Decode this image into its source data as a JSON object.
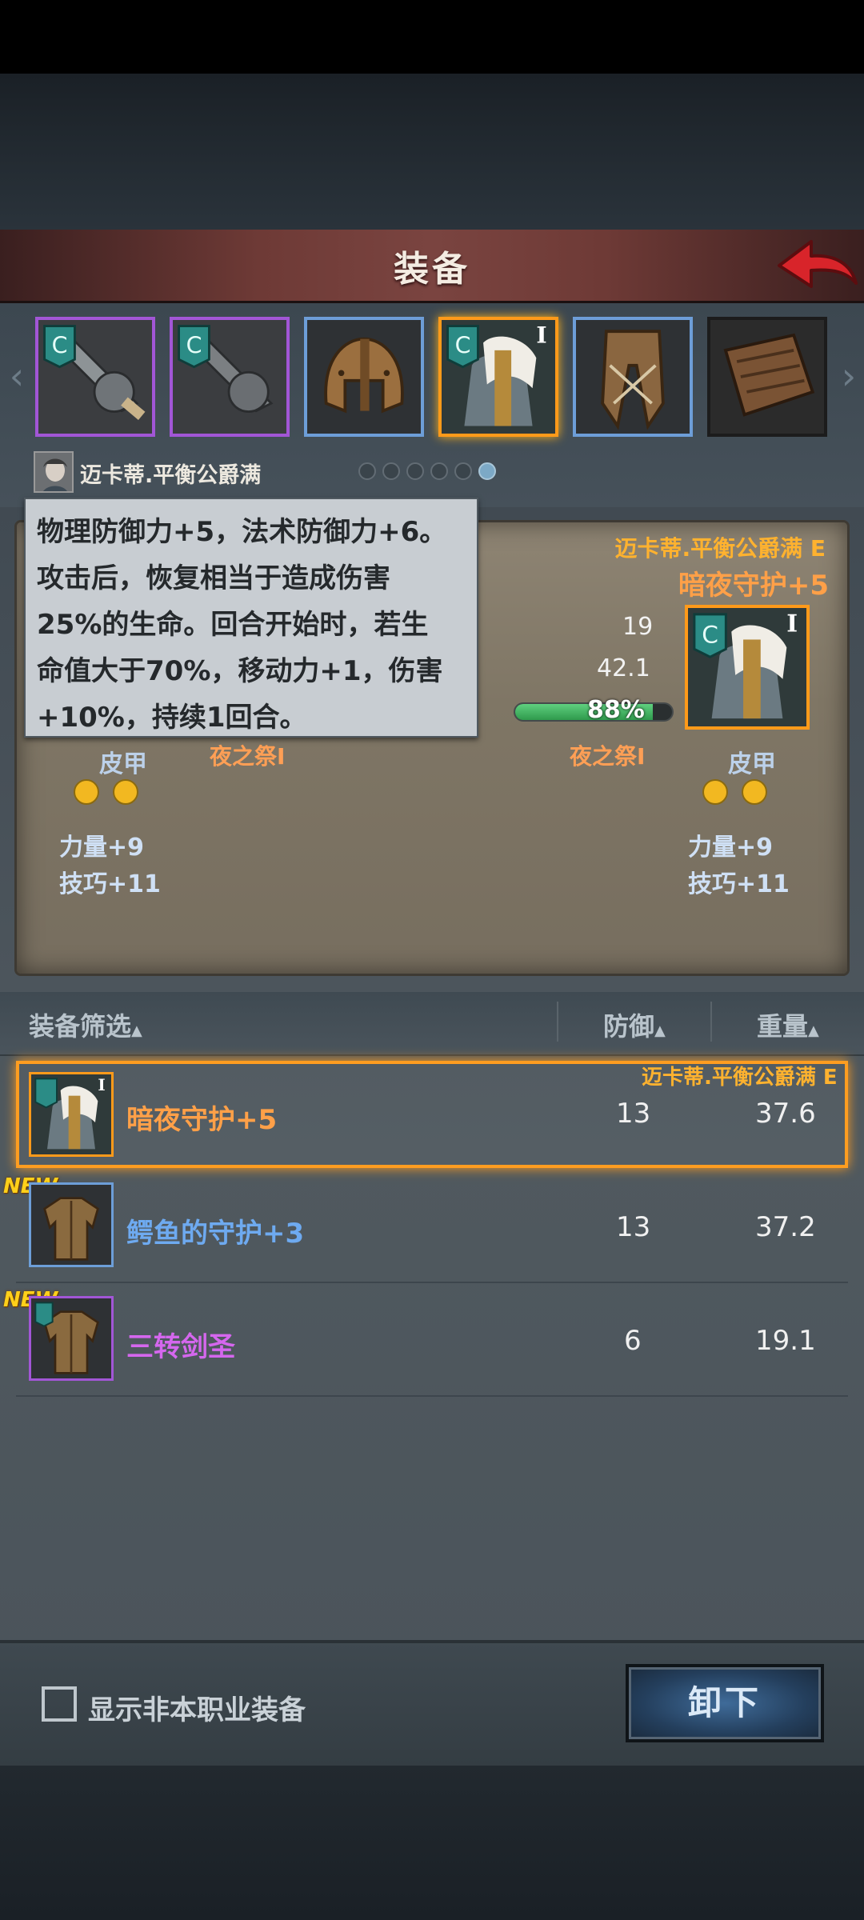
{
  "header": {
    "title": "装备"
  },
  "character": {
    "name": "迈卡蒂.平衡公爵满"
  },
  "tooltip": {
    "lines": [
      "物理防御力+5，法术防御力+6。",
      "攻击后，恢复相当于造成伤害",
      "25%的生命。回合开始时，若生",
      "命值大于70%，移动力+1，伤害",
      "+10%，持续1回合。"
    ]
  },
  "compare": {
    "left": {
      "rune": "夜之祭I",
      "type": "皮甲",
      "stat1": "力量+9",
      "stat2": "技巧+11"
    },
    "right": {
      "owner": "迈卡蒂.平衡公爵满 E",
      "name": "暗夜守护+5",
      "defense": "19",
      "weight": "42.1",
      "durability": "88%",
      "durability_value": 0.88,
      "rune": "夜之祭I",
      "type": "皮甲",
      "stat1": "力量+9",
      "stat2": "技巧+11"
    }
  },
  "list_header": {
    "filter": "装备筛选",
    "defense": "防御",
    "weight": "重量"
  },
  "rows": [
    {
      "name": "暗夜守护+5",
      "owner": "迈卡蒂.平衡公爵满 E",
      "defense": "13",
      "weight": "37.6",
      "badge": "",
      "color": "#ffa048"
    },
    {
      "name": "鳄鱼的守护+3",
      "owner": "",
      "defense": "13",
      "weight": "37.2",
      "badge": "NEW",
      "color": "#6eaaf0"
    },
    {
      "name": "三转剑圣",
      "owner": "",
      "defense": "6",
      "weight": "19.1",
      "badge": "NEW",
      "color": "#d567ee"
    }
  ],
  "bottom": {
    "checkbox_label": "显示非本职业装备",
    "unequip_label": "卸下"
  }
}
